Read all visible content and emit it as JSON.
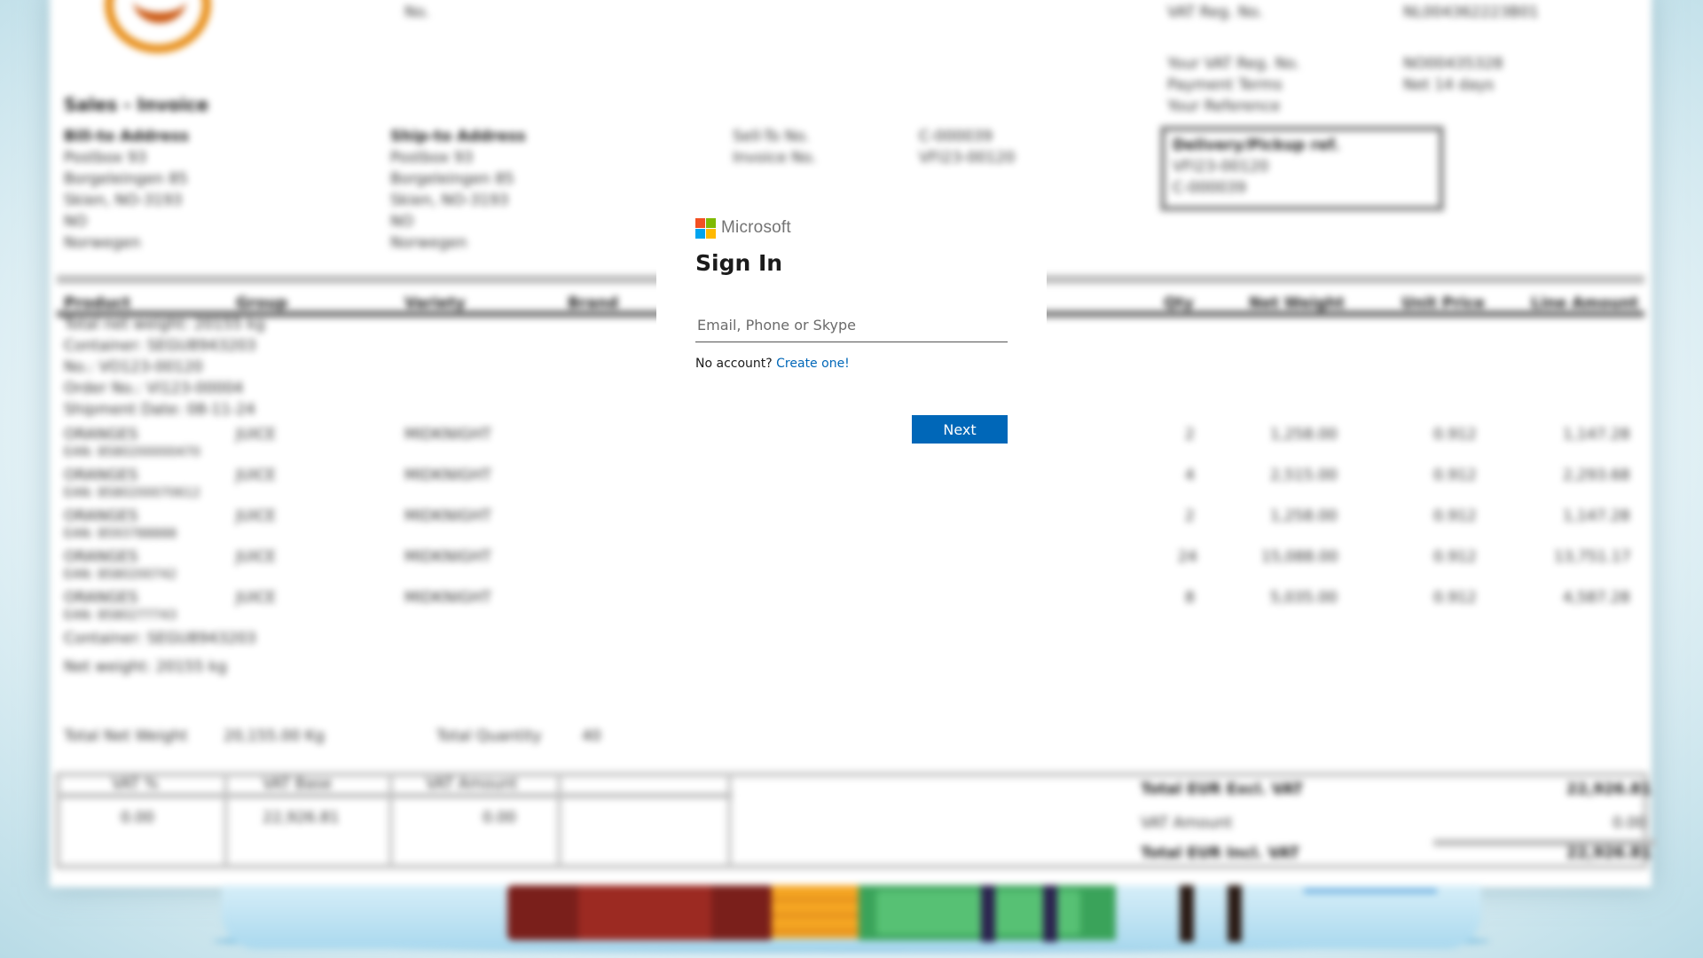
{
  "background_document": {
    "title": "Sales - Invoice",
    "header_right": [
      {
        "label": "VAT Reg. No.",
        "value": "NL004362223B01"
      },
      {
        "label": "Your VAT Reg. No.",
        "value": "NO00435328"
      },
      {
        "label": "Payment Terms",
        "value": "Net 14 days"
      },
      {
        "label": "Your Reference",
        "value": ""
      }
    ],
    "top_center_label": "No.",
    "bill_to": [
      "Bill-to Address",
      "Postbox 93",
      "Borgeleingen 85",
      "Skien, NO-3193",
      "NO",
      "Norwegen"
    ],
    "ship_to": [
      "Ship-to Address",
      "Postbox 93",
      "Borgeleingen 85",
      "Skien, NO-3193",
      "NO",
      "Norwegen"
    ],
    "meta": [
      {
        "label": "Sell-To No.",
        "value": "C-000039"
      },
      {
        "label": "Invoice No.",
        "value": "VFI23-00120"
      }
    ],
    "delivery_box": [
      "Delivery/Pickup ref.",
      "VFI23-00120",
      "C-000039"
    ],
    "columns": [
      "Product",
      "Group",
      "Variety",
      "Brand",
      "Qty",
      "Net Weight",
      "Unit Price",
      "Line Amount"
    ],
    "notes": [
      "Total net weight: 20155 kg",
      "Container: SEGU8943203",
      "No.: VO123-00120",
      "Order No.: VI123-00004",
      "Shipment Date: 08-11-24"
    ],
    "rows": [
      {
        "product": "ORANGES",
        "group": "JUICE",
        "variety": "MIDKNIGHT",
        "qty": "2",
        "weight": "1,258.00",
        "price": "0.912",
        "amount": "1,147.28",
        "code": "EAN: 8580200000470"
      },
      {
        "product": "ORANGES",
        "group": "JUICE",
        "variety": "MIDKNIGHT",
        "qty": "4",
        "weight": "2,515.00",
        "price": "0.912",
        "amount": "2,293.68",
        "code": "EAN: 8580200070612"
      },
      {
        "product": "ORANGES",
        "group": "JUICE",
        "variety": "MIDKNIGHT",
        "qty": "2",
        "weight": "1,258.00",
        "price": "0.912",
        "amount": "1,147.28",
        "code": "EAN: 8593788888"
      },
      {
        "product": "ORANGES",
        "group": "JUICE",
        "variety": "MIDKNIGHT",
        "qty": "24",
        "weight": "15,088.00",
        "price": "0.912",
        "amount": "13,751.17",
        "code": "EAN: 8580200742"
      },
      {
        "product": "ORANGES",
        "group": "JUICE",
        "variety": "MIDKNIGHT",
        "qty": "8",
        "weight": "5,035.00",
        "price": "0.912",
        "amount": "4,587.28",
        "code": "EAN: 8580277743"
      }
    ],
    "footer_note": "Container: SEGU8943203",
    "net_weight_note": "Net weight: 20155 kg",
    "totals_line": {
      "label1": "Total Net Weight",
      "value1": "20,155.00 Kg",
      "label2": "Total Quantity",
      "value2": "40"
    },
    "vat_table": {
      "headers": [
        "VAT %",
        "VAT Base",
        "VAT Amount"
      ],
      "values": [
        "0.00",
        "22,926.81",
        "0.00"
      ]
    },
    "summary": [
      {
        "label": "Total EUR Excl. VAT",
        "value": "22,926.81"
      },
      {
        "label": "VAT Amount",
        "value": "0.00"
      },
      {
        "label": "Total EUR Incl. VAT",
        "value": "22,926.81"
      }
    ]
  },
  "dialog": {
    "brand_name": "Microsoft",
    "title": "Sign In",
    "email_placeholder": "Email, Phone or Skype",
    "email_value": "",
    "no_account_text": "No account?",
    "create_link": "Create one!",
    "next_label": "Next"
  },
  "colors": {
    "primary_button": "#0067b8",
    "link": "#0067b8",
    "logo_red": "#f25022",
    "logo_green": "#7fba00",
    "logo_blue": "#00a4ef",
    "logo_yellow": "#ffb900"
  }
}
